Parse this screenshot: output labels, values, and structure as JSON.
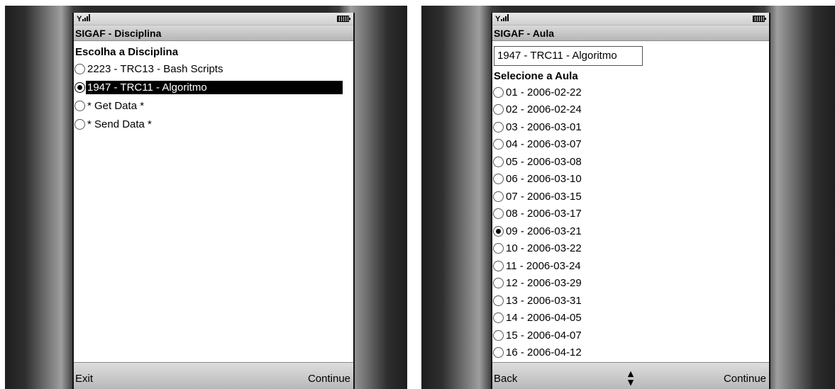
{
  "left_screen": {
    "title": "SIGAF - Disciplina",
    "heading": "Escolha a Disciplina",
    "options": [
      {
        "label": "2223 - TRC13 - Bash Scripts",
        "selected": false
      },
      {
        "label": "1947 - TRC11 - Algoritmo",
        "selected": true
      },
      {
        "label": "* Get Data *",
        "selected": false
      },
      {
        "label": "* Send Data *",
        "selected": false
      }
    ],
    "softkey_left": "Exit",
    "softkey_right": "Continue"
  },
  "right_screen": {
    "title": "SIGAF - Aula",
    "field_value": "1947 - TRC11 - Algoritmo",
    "heading": "Selecione a Aula",
    "options": [
      {
        "label": "01 - 2006-02-22",
        "selected": false
      },
      {
        "label": "02 - 2006-02-24",
        "selected": false
      },
      {
        "label": "03 - 2006-03-01",
        "selected": false
      },
      {
        "label": "04 - 2006-03-07",
        "selected": false
      },
      {
        "label": "05 - 2006-03-08",
        "selected": false
      },
      {
        "label": "06 - 2006-03-10",
        "selected": false
      },
      {
        "label": "07 - 2006-03-15",
        "selected": false
      },
      {
        "label": "08 - 2006-03-17",
        "selected": false
      },
      {
        "label": "09 - 2006-03-21",
        "selected": true
      },
      {
        "label": "10 - 2006-03-22",
        "selected": false
      },
      {
        "label": "11 - 2006-03-24",
        "selected": false
      },
      {
        "label": "12 - 2006-03-29",
        "selected": false
      },
      {
        "label": "13 - 2006-03-31",
        "selected": false
      },
      {
        "label": "14 - 2006-04-05",
        "selected": false
      },
      {
        "label": "15 - 2006-04-07",
        "selected": false
      },
      {
        "label": "16 - 2006-04-12",
        "selected": false
      }
    ],
    "softkey_left": "Back",
    "softkey_right": "Continue",
    "scroll_icon": "up-down-arrow-icon"
  },
  "status_icons": [
    "signal-strength-icon",
    "battery-icon"
  ]
}
